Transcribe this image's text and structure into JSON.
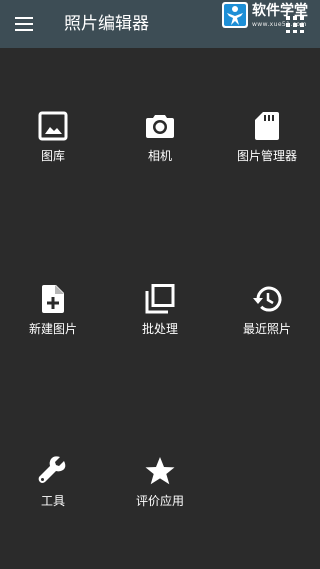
{
  "app_bar": {
    "title": "照片编辑器",
    "background": "#3d4d55",
    "menu_icon": "hamburger-menu-icon",
    "overflow_icon": "grid-dots-icon"
  },
  "watermark": {
    "title": "软件学堂",
    "url": "www.xue51.com",
    "accent": "#1e8fd6"
  },
  "background": "#2b2b2b",
  "menu": {
    "items": [
      {
        "label": "图库",
        "icon": "image-icon"
      },
      {
        "label": "相机",
        "icon": "camera-icon"
      },
      {
        "label": "图片管理器",
        "icon": "sd-card-icon"
      },
      {
        "label": "新建图片",
        "icon": "new-file-icon"
      },
      {
        "label": "批处理",
        "icon": "batch-copy-icon"
      },
      {
        "label": "最近照片",
        "icon": "history-icon"
      },
      {
        "label": "工具",
        "icon": "wrench-icon"
      },
      {
        "label": "评价应用",
        "icon": "star-icon"
      }
    ]
  }
}
